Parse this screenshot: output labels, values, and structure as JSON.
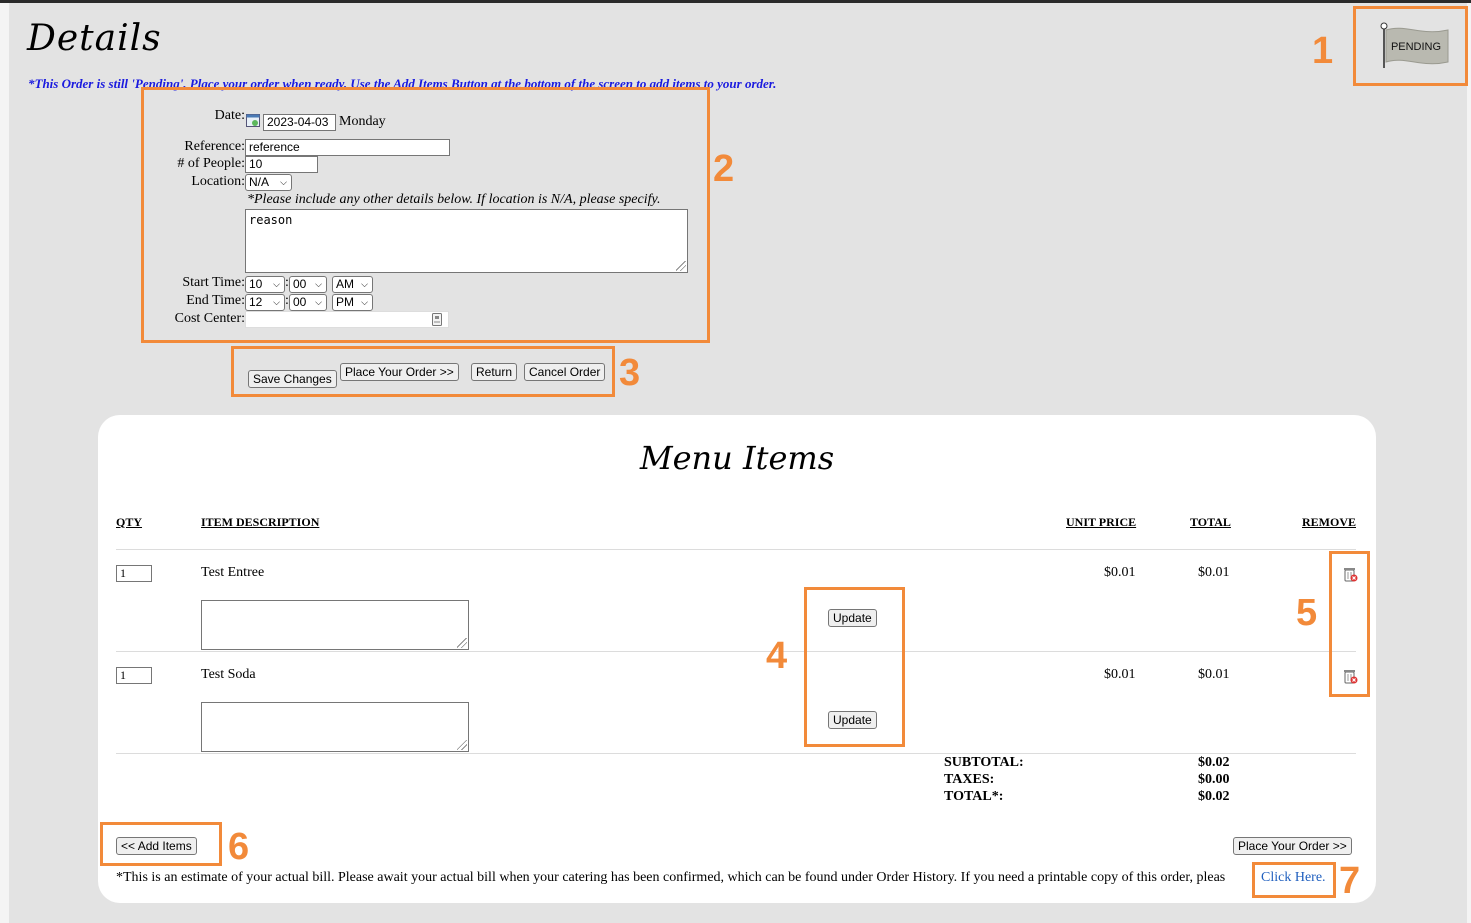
{
  "header": {
    "title": "Details",
    "status_flag": "PENDING",
    "notice": "*This Order is still 'Pending'. Place your order when ready. Use the Add Items Button at the bottom of the screen to add items to your order."
  },
  "form": {
    "date_label": "Date:",
    "date_value": "2023-04-03",
    "day_name": "Monday",
    "reference_label": "Reference:",
    "reference_value": "reference",
    "people_label": "# of People:",
    "people_value": "10",
    "location_label": "Location:",
    "location_value": "N/A",
    "details_hint": "*Please include any other details below. If location is N/A, please specify.",
    "details_value": "reason",
    "start_label": "Start Time:",
    "start_hour": "10",
    "start_minute": "00",
    "start_ampm": "AM",
    "end_label": "End Time:",
    "end_hour": "12",
    "end_minute": "00",
    "end_ampm": "PM",
    "colon": ":",
    "cost_center_label": "Cost Center:",
    "cost_center_value": ""
  },
  "actions": {
    "save": "Save Changes",
    "place": "Place Your Order >>",
    "return": "Return",
    "cancel": "Cancel Order"
  },
  "menu": {
    "title": "Menu Items",
    "columns": {
      "qty": "QTY",
      "description": "ITEM DESCRIPTION",
      "unit_price": "UNIT PRICE",
      "total": "TOTAL",
      "remove": "REMOVE"
    },
    "items": [
      {
        "qty": "1",
        "description": "Test Entree",
        "unit_price": "$0.01",
        "total": "$0.01",
        "update_label": "Update",
        "note": ""
      },
      {
        "qty": "1",
        "description": "Test Soda",
        "unit_price": "$0.01",
        "total": "$0.01",
        "update_label": "Update",
        "note": ""
      }
    ],
    "subtotal_label": "SUBTOTAL:",
    "subtotal_value": "$0.02",
    "taxes_label": "TAXES:",
    "taxes_value": "$0.00",
    "total_label": "TOTAL*:",
    "total_value": "$0.02",
    "add_items": "<< Add Items",
    "place_order": "Place Your Order >>",
    "footnote": "*This is an estimate of your actual bill. Please await your actual bill when your catering has been confirmed, which can be found under Order History. If you need a printable copy of this order, pleas",
    "footnote_link": "Click Here."
  },
  "annotations": {
    "n1": "1",
    "n2": "2",
    "n3": "3",
    "n4": "4",
    "n5": "5",
    "n6": "6",
    "n7": "7"
  },
  "colors": {
    "annotation": "#f28a3a",
    "notice": "#1a1adf",
    "link": "#1f5fbf",
    "background": "#e3e3e3"
  }
}
